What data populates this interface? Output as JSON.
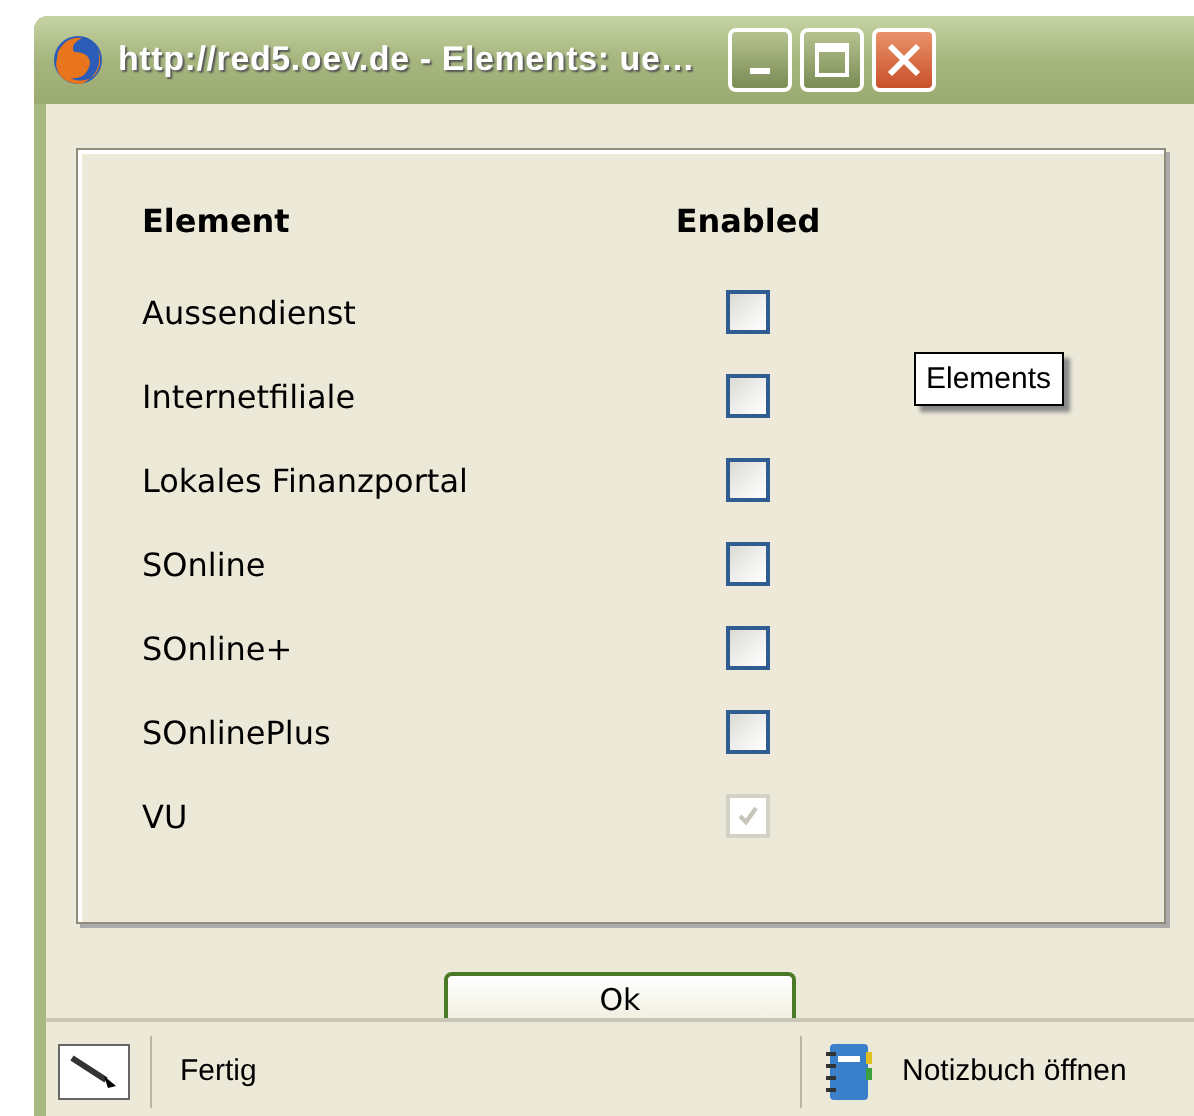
{
  "window": {
    "title": "http://red5.oev.de - Elements: ue…"
  },
  "table": {
    "columns": [
      "Element",
      "Enabled"
    ],
    "rows": [
      {
        "label": "Aussendienst",
        "checked": false,
        "disabled": false
      },
      {
        "label": "Internetfiliale",
        "checked": false,
        "disabled": false
      },
      {
        "label": "Lokales Finanzportal",
        "checked": false,
        "disabled": false
      },
      {
        "label": "SOnline",
        "checked": false,
        "disabled": false
      },
      {
        "label": "SOnline+",
        "checked": false,
        "disabled": false
      },
      {
        "label": "SOnlinePlus",
        "checked": false,
        "disabled": false
      },
      {
        "label": "VU",
        "checked": true,
        "disabled": true
      }
    ]
  },
  "tooltip": "Elements",
  "ok_button": "Ok",
  "status_bar": {
    "status": "Fertig",
    "notebook": "Notizbuch öffnen"
  }
}
